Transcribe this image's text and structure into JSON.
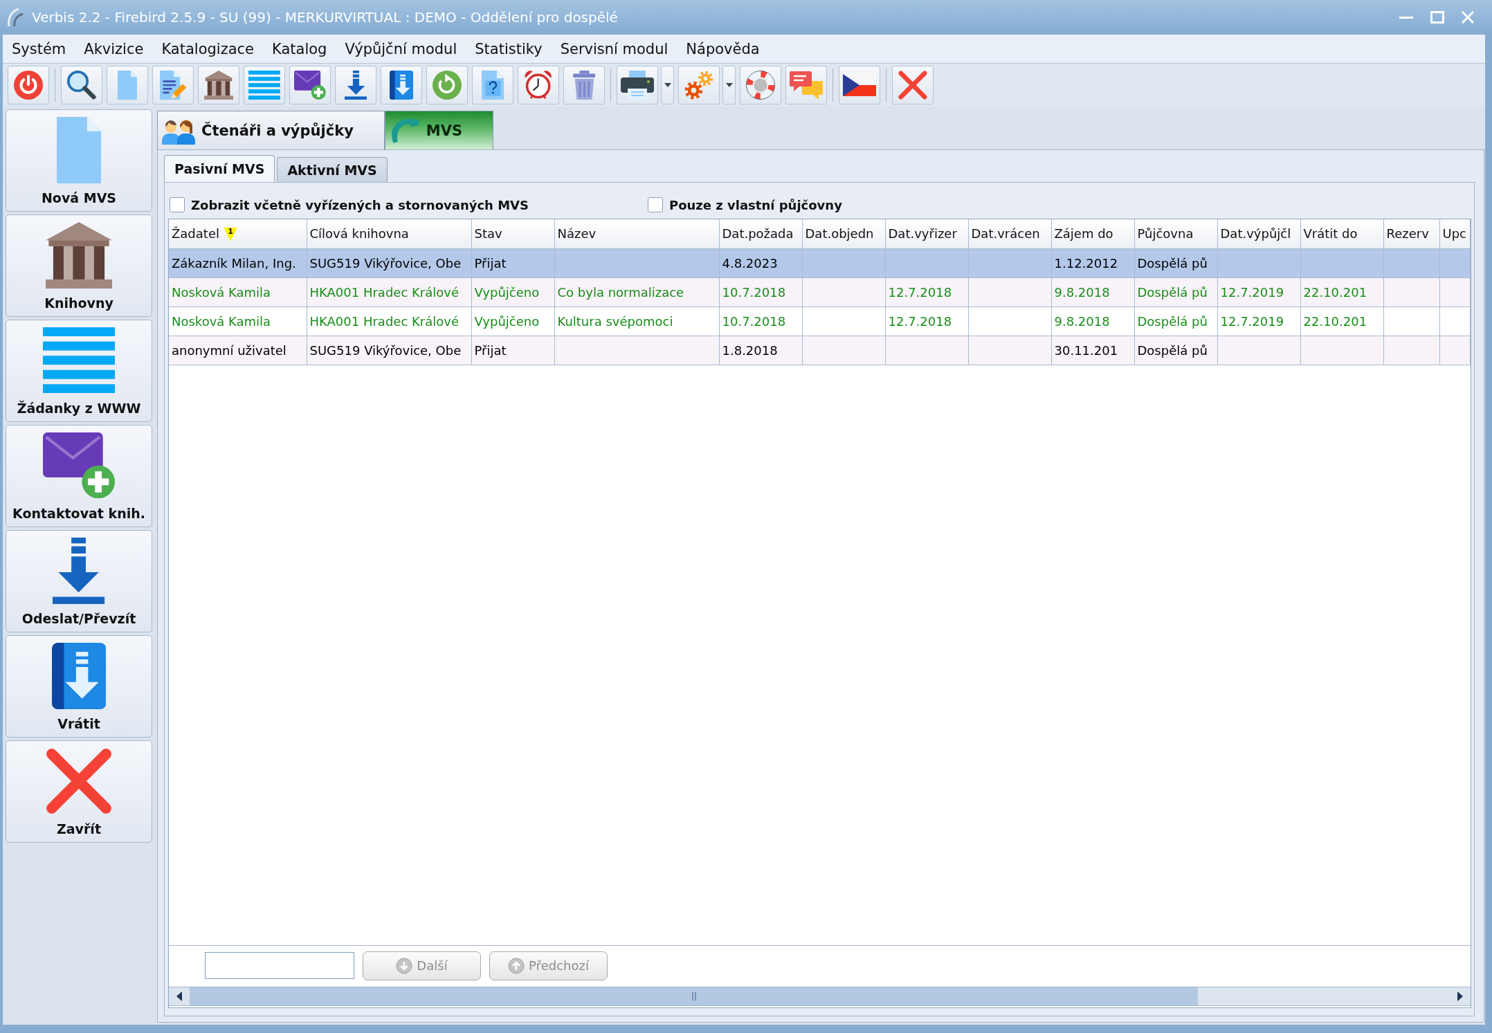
{
  "window": {
    "title": "Verbis 2.2 - Firebird 2.5.9 - SU (99) - MERKURVIRTUAL : DEMO - Oddělení pro dospělé"
  },
  "menu": [
    "Systém",
    "Akvizice",
    "Katalogizace",
    "Katalog",
    "Výpůjční modul",
    "Statistiky",
    "Servisní modul",
    "Nápověda"
  ],
  "sidebar": {
    "items": [
      {
        "label": "Nová MVS"
      },
      {
        "label": "Knihovny"
      },
      {
        "label": "Žádanky z WWW"
      },
      {
        "label": "Kontaktovat knih."
      },
      {
        "label": "Odeslat/Převzít"
      },
      {
        "label": "Vrátit"
      },
      {
        "label": "Zavřít"
      }
    ]
  },
  "tabs": [
    {
      "label": "Čtenáři a výpůjčky",
      "selected": false
    },
    {
      "label": "MVS",
      "selected": true
    }
  ],
  "subtabs": [
    {
      "label": "Pasivní MVS",
      "selected": true
    },
    {
      "label": "Aktivní MVS",
      "selected": false
    }
  ],
  "filters": [
    {
      "label": "Zobrazit včetně vyřízených a stornovaných MVS",
      "checked": false
    },
    {
      "label": "Pouze z vlastní půjčovny",
      "checked": false
    }
  ],
  "table": {
    "columns": [
      {
        "label": "Žadatel",
        "sort_order": "1"
      },
      {
        "label": "Cílová knihovna"
      },
      {
        "label": "Stav"
      },
      {
        "label": "Název"
      },
      {
        "label": "Dat.požada"
      },
      {
        "label": "Dat.objedn"
      },
      {
        "label": "Dat.vyřizer"
      },
      {
        "label": "Dat.vrácen"
      },
      {
        "label": "Zájem do"
      },
      {
        "label": "Půjčovna"
      },
      {
        "label": "Dat.výpůjčl"
      },
      {
        "label": "Vrátit do"
      },
      {
        "label": "Rezerv"
      },
      {
        "label": "Upc"
      }
    ],
    "rows": [
      {
        "selected": true,
        "color": "#000000",
        "cells": [
          "Zákazník Milan, Ing.",
          "SUG519 Vikýřovice, Obe",
          "Přijat",
          null,
          "4.8.2023",
          null,
          null,
          null,
          "1.12.2012",
          "Dospělá pů",
          null,
          null,
          null,
          null
        ]
      },
      {
        "selected": false,
        "color": "#1a8c1a",
        "cells": [
          "Nosková Kamila",
          "HKA001 Hradec Králové",
          "Vypůjčeno",
          "Co byla normalizace",
          "10.7.2018",
          null,
          "12.7.2018",
          null,
          "9.8.2018",
          "Dospělá pů",
          "12.7.2019",
          "22.10.201",
          null,
          null
        ]
      },
      {
        "selected": false,
        "color": "#1a8c1a",
        "cells": [
          "Nosková Kamila",
          "HKA001 Hradec Králové",
          "Vypůjčeno",
          "Kultura svépomoci",
          "10.7.2018",
          null,
          "12.7.2018",
          null,
          "9.8.2018",
          "Dospělá pů",
          "12.7.2019",
          "22.10.201",
          null,
          null
        ]
      },
      {
        "selected": false,
        "color": "#000000",
        "cells": [
          "anonymní uživatel",
          "SUG519 Vikýřovice, Obe",
          "Přijat",
          null,
          "1.8.2018",
          null,
          null,
          null,
          "30.11.201",
          "Dospělá pů",
          null,
          null,
          null,
          null
        ]
      }
    ]
  },
  "search": {
    "buttons": [
      {
        "label": "Další",
        "disabled": true
      },
      {
        "label": "Předchozí",
        "disabled": true
      }
    ]
  }
}
